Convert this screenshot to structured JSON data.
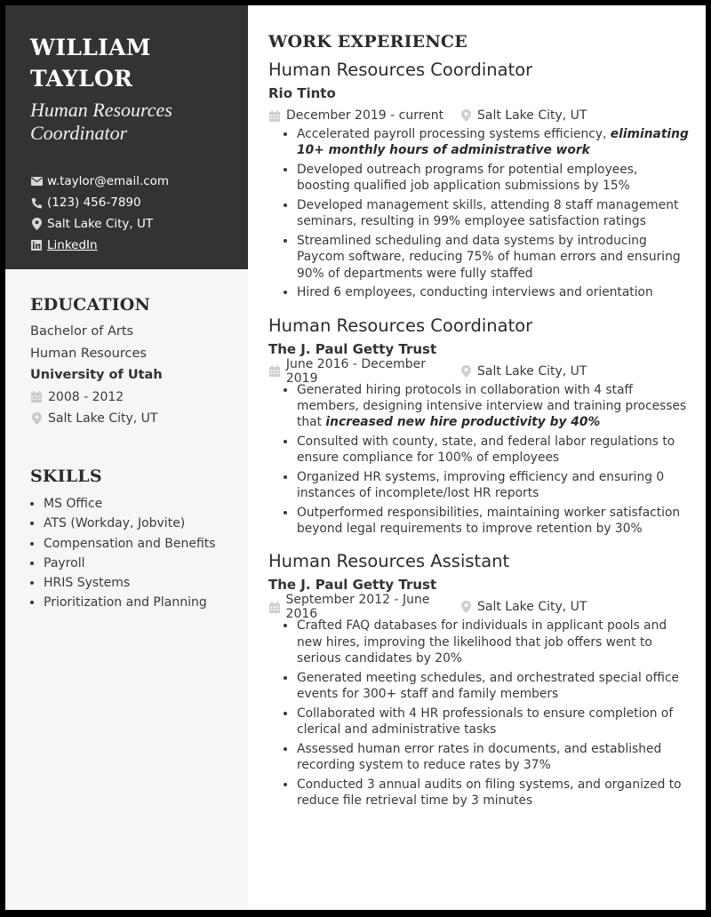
{
  "header": {
    "name_line1": "WILLIAM",
    "name_line2": "TAYLOR",
    "title_line1": "Human Resources",
    "title_line2": "Coordinator",
    "contacts": [
      {
        "icon": "envelope-icon",
        "text": "w.taylor@email.com"
      },
      {
        "icon": "phone-icon",
        "text": "(123) 456-7890"
      },
      {
        "icon": "map-pin-icon",
        "text": "Salt Lake City, UT"
      },
      {
        "icon": "linkedin-icon",
        "text": "LinkedIn"
      }
    ]
  },
  "education": {
    "title": "EDUCATION",
    "degree": "Bachelor of Arts",
    "field": "Human Resources",
    "school": "University of Utah",
    "dates": "2008 - 2012",
    "location": "Salt Lake City, UT"
  },
  "skills": {
    "title": "SKILLS",
    "items": [
      "MS Office",
      "ATS (Workday, Jobvite)",
      "Compensation and Benefits",
      "Payroll",
      "HRIS Systems",
      "Prioritization and Planning"
    ]
  },
  "experience": {
    "title": "WORK EXPERIENCE",
    "jobs": [
      {
        "title": "Human Resources Coordinator",
        "company": "Rio Tinto",
        "dates": "December 2019 - current",
        "location": "Salt Lake City, UT",
        "bullets": [
          {
            "text": "Accelerated payroll processing systems efficiency, ",
            "emph": "eliminating 10+ monthly hours of administrative work",
            "after": ""
          },
          {
            "text": "Developed outreach programs for potential employees, boosting qualified job application submissions by 15%",
            "emph": "",
            "after": ""
          },
          {
            "text": "Developed management skills, attending 8 staff management seminars, resulting in 99% employee satisfaction ratings",
            "emph": "",
            "after": ""
          },
          {
            "text": "Streamlined scheduling and data systems by introducing Paycom software, reducing 75% of human errors and ensuring 90% of departments were fully staffed",
            "emph": "",
            "after": ""
          },
          {
            "text": "Hired 6 employees, conducting interviews and orientation",
            "emph": "",
            "after": ""
          }
        ]
      },
      {
        "title": "Human Resources Coordinator",
        "company": "The J. Paul Getty Trust",
        "dates": "June 2016 - December 2019",
        "location": "Salt Lake City, UT",
        "bullets": [
          {
            "text": "Generated hiring protocols in collaboration with 4 staff members, designing intensive interview and training processes that ",
            "emph": "increased new hire productivity by 40%",
            "after": ""
          },
          {
            "text": "Consulted with county, state, and federal labor regulations to ensure compliance for 100% of employees",
            "emph": "",
            "after": ""
          },
          {
            "text": "Organized HR systems, improving efficiency and ensuring 0 instances of incomplete/lost HR reports",
            "emph": "",
            "after": ""
          },
          {
            "text": "Outperformed responsibilities, maintaining worker satisfaction beyond legal requirements to improve retention by 30%",
            "emph": "",
            "after": ""
          }
        ]
      },
      {
        "title": "Human Resources Assistant",
        "company": "The J. Paul Getty Trust",
        "dates": "September 2012 - June 2016",
        "location": "Salt Lake City, UT",
        "bullets": [
          {
            "text": "Crafted FAQ databases for individuals in applicant pools and new hires, improving the likelihood that job offers went to serious candidates by 20%",
            "emph": "",
            "after": ""
          },
          {
            "text": "Generated meeting schedules, and orchestrated special office events for 300+ staff and family members",
            "emph": "",
            "after": ""
          },
          {
            "text": "Collaborated with 4 HR professionals to ensure completion of clerical and administrative tasks",
            "emph": "",
            "after": ""
          },
          {
            "text": "Assessed human error rates in documents, and established recording system to reduce rates by 37%",
            "emph": "",
            "after": ""
          },
          {
            "text": "Conducted 3 annual audits on filing systems, and organized to reduce file retrieval time by 3 minutes",
            "emph": "",
            "after": ""
          }
        ]
      }
    ]
  },
  "colors": {
    "header_bg": "#333333",
    "sidebar_bg": "#f6f6f6",
    "icon_gray": "#c4c4c4",
    "text": "#3a3a3a"
  }
}
